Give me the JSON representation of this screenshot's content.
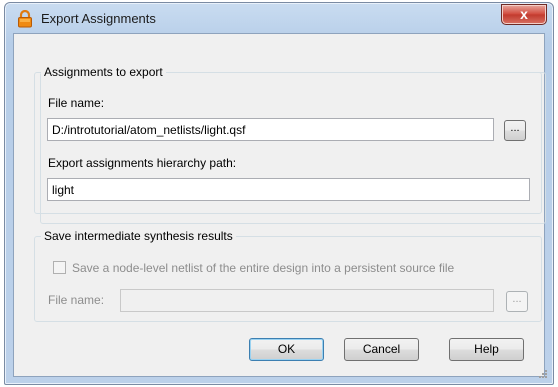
{
  "window": {
    "title": "Export Assignments",
    "close_label": "x"
  },
  "assignments_group": {
    "legend": "Assignments to export",
    "file_name_label": "File name:",
    "file_name_value": "D:/introtutorial/atom_netlists/light.qsf",
    "browse_label": "...",
    "hierarchy_label": "Export assignments hierarchy path:",
    "hierarchy_value": "light"
  },
  "synthesis_group": {
    "legend": "Save intermediate synthesis results",
    "checkbox_label": "Save a node-level netlist of the entire design into a persistent source file",
    "checkbox_checked": false,
    "file_name_label": "File name:",
    "file_name_value": "",
    "browse_label": "..."
  },
  "buttons": {
    "ok": "OK",
    "cancel": "Cancel",
    "help": "Help"
  },
  "colors": {
    "title_bar": "#bcd1ea",
    "close_button": "#c13a2d",
    "dialog_background": "#f0f0f0",
    "disabled_text": "#8d8d8d",
    "default_button_border": "#3c7fb1"
  }
}
